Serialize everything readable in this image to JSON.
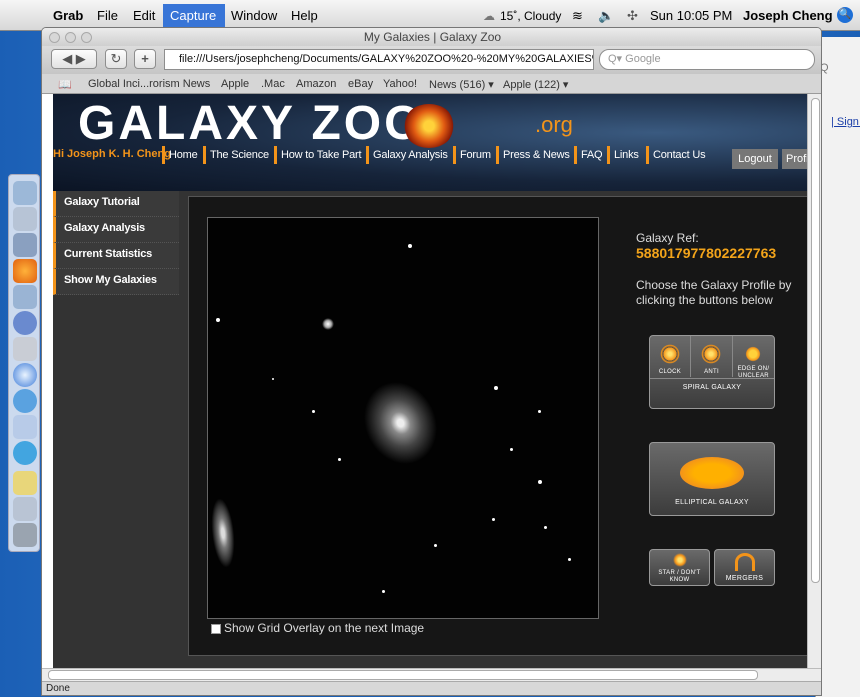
{
  "menubar": {
    "app": "Grab",
    "items": [
      "File",
      "Edit",
      "Capture",
      "Window",
      "Help"
    ],
    "weather": "15˚, Cloudy",
    "clock": "Sun 10:05 PM",
    "user": "Joseph Cheng"
  },
  "window": {
    "title": "My Galaxies | Galaxy Zoo",
    "url": "file:///Users/josephcheng/Documents/GALAXY%20ZOO%20-%20MY%20GALAXIES%",
    "search_placeholder": "Google",
    "status": "Done"
  },
  "bookmarks": [
    "Global Inci...rorism News",
    "Apple",
    ".Mac",
    "Amazon",
    "eBay",
    "Yahoo!",
    "News (516) ▾",
    "Apple (122) ▾"
  ],
  "site": {
    "logo": "GALAXY ZOO",
    "logo_suffix": ".org",
    "greeting": "Hi Joseph K. H. Cheng",
    "nav": [
      "Home",
      "The Science",
      "How to Take Part",
      "Galaxy Analysis",
      "Forum",
      "Press & News",
      "FAQ",
      "Links",
      "Contact Us"
    ],
    "logout": "Logout",
    "profile": "Profi",
    "sidebar": [
      "Galaxy Tutorial",
      "Galaxy Analysis",
      "Current Statistics",
      "Show My Galaxies"
    ]
  },
  "classifier": {
    "ref_label": "Galaxy Ref:",
    "ref_value": "588017977802227763",
    "instructions": "Choose the Galaxy Profile by clicking the buttons below",
    "spiral": {
      "clock": "CLOCK",
      "anti": "ANTI",
      "edge": "EDGE ON/ UNCLEAR",
      "title": "SPIRAL GALAXY"
    },
    "elliptical": "ELLIPTICAL GALAXY",
    "star": "STAR / DON'T KNOW",
    "mergers": "MERGERS",
    "grid_overlay": "Show Grid Overlay on the next Image"
  },
  "bg_window": {
    "sign_in": "| Sign i"
  },
  "colors": {
    "accent": "#f3941a",
    "panel": "#161616"
  }
}
